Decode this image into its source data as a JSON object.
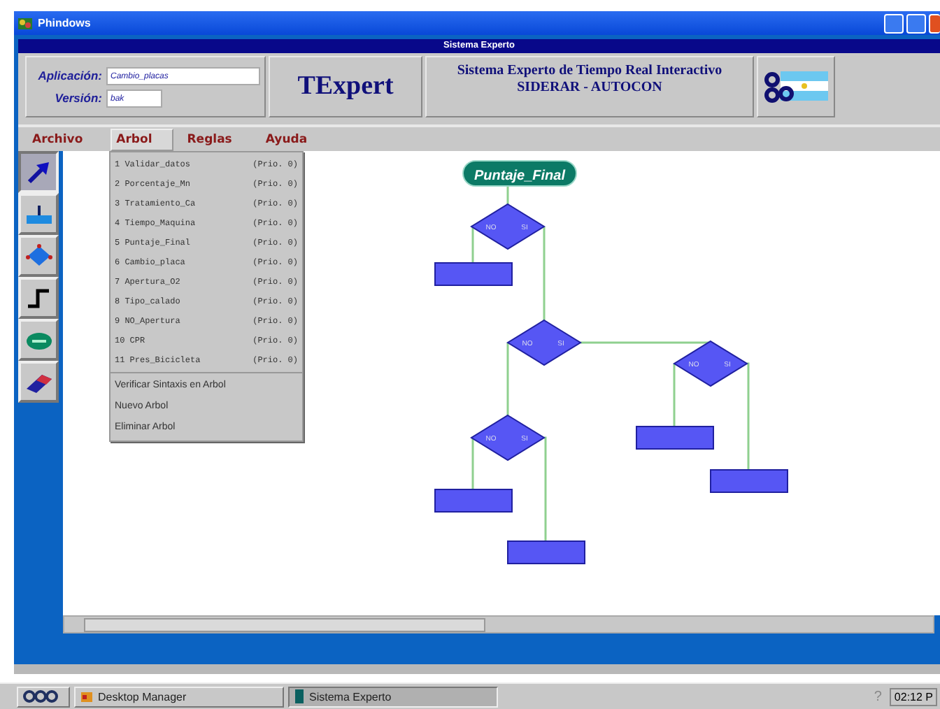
{
  "window": {
    "title": "Phindows"
  },
  "app_title": "Sistema Experto",
  "header": {
    "fields": [
      {
        "label": "Aplicación:",
        "value": "Cambio_placas"
      },
      {
        "label": "Versión:",
        "value": "bak"
      }
    ],
    "logo": "TExpert",
    "subtitle": [
      "Sistema Experto de Tiempo Real Interactivo",
      "SIDERAR - AUTOCON"
    ]
  },
  "menu": [
    {
      "label": "Archivo",
      "selected": false
    },
    {
      "label": "Arbol",
      "selected": true
    },
    {
      "label": "Reglas",
      "selected": false
    },
    {
      "label": "Ayuda",
      "selected": false
    }
  ],
  "dropdown": {
    "rules": [
      {
        "number": "1",
        "name": "Validar_datos",
        "priority": "(Prio. 0)"
      },
      {
        "number": "2",
        "name": "Porcentaje_Mn",
        "priority": "(Prio. 0)"
      },
      {
        "number": "3",
        "name": "Tratamiento_Ca",
        "priority": "(Prio. 0)"
      },
      {
        "number": "4",
        "name": "Tiempo_Maquina",
        "priority": "(Prio. 0)"
      },
      {
        "number": "5",
        "name": "Puntaje_Final",
        "priority": "(Prio. 0)"
      },
      {
        "number": "6",
        "name": "Cambio_placa",
        "priority": "(Prio. 0)"
      },
      {
        "number": "7",
        "name": "Apertura_O2",
        "priority": "(Prio. 0)"
      },
      {
        "number": "8",
        "name": "Tipo_calado",
        "priority": "(Prio. 0)"
      },
      {
        "number": "9",
        "name": "NO_Apertura",
        "priority": "(Prio. 0)"
      },
      {
        "number": "10",
        "name": "CPR",
        "priority": "(Prio. 0)"
      },
      {
        "number": "11",
        "name": "Pres_Bicicleta",
        "priority": "(Prio. 0)"
      }
    ],
    "actions": [
      "Verificar Sintaxis en Arbol",
      "Nuevo Arbol",
      "Eliminar Arbol"
    ]
  },
  "tools": [
    {
      "kind": "pointer",
      "selected": true
    },
    {
      "kind": "action",
      "selected": false
    },
    {
      "kind": "decision",
      "selected": false
    },
    {
      "kind": "connector",
      "selected": false
    },
    {
      "kind": "end",
      "selected": false
    },
    {
      "kind": "eraser",
      "selected": false
    }
  ],
  "tree": {
    "label": "Puntaje_Final",
    "children": [
      {
        "kind": "decision",
        "no": "NO",
        "yes": "SI",
        "children": [
          {
            "kind": "action"
          },
          {
            "kind": "decision",
            "no": "NO",
            "yes": "SI",
            "children": [
              {
                "kind": "decision",
                "no": "NO",
                "yes": "SI",
                "children": [
                  {
                    "kind": "action"
                  },
                  {
                    "kind": "action"
                  }
                ]
              },
              {
                "kind": "decision",
                "no": "NO",
                "yes": "SI",
                "children": [
                  {
                    "kind": "action"
                  },
                  {
                    "kind": "action"
                  }
                ]
              }
            ]
          }
        ]
      }
    ]
  },
  "taskbar": {
    "tasks": [
      {
        "label": "Desktop Manager",
        "selected": false
      },
      {
        "label": "Sistema Experto",
        "selected": true
      }
    ],
    "help": "?",
    "clock": "02:12 P"
  }
}
